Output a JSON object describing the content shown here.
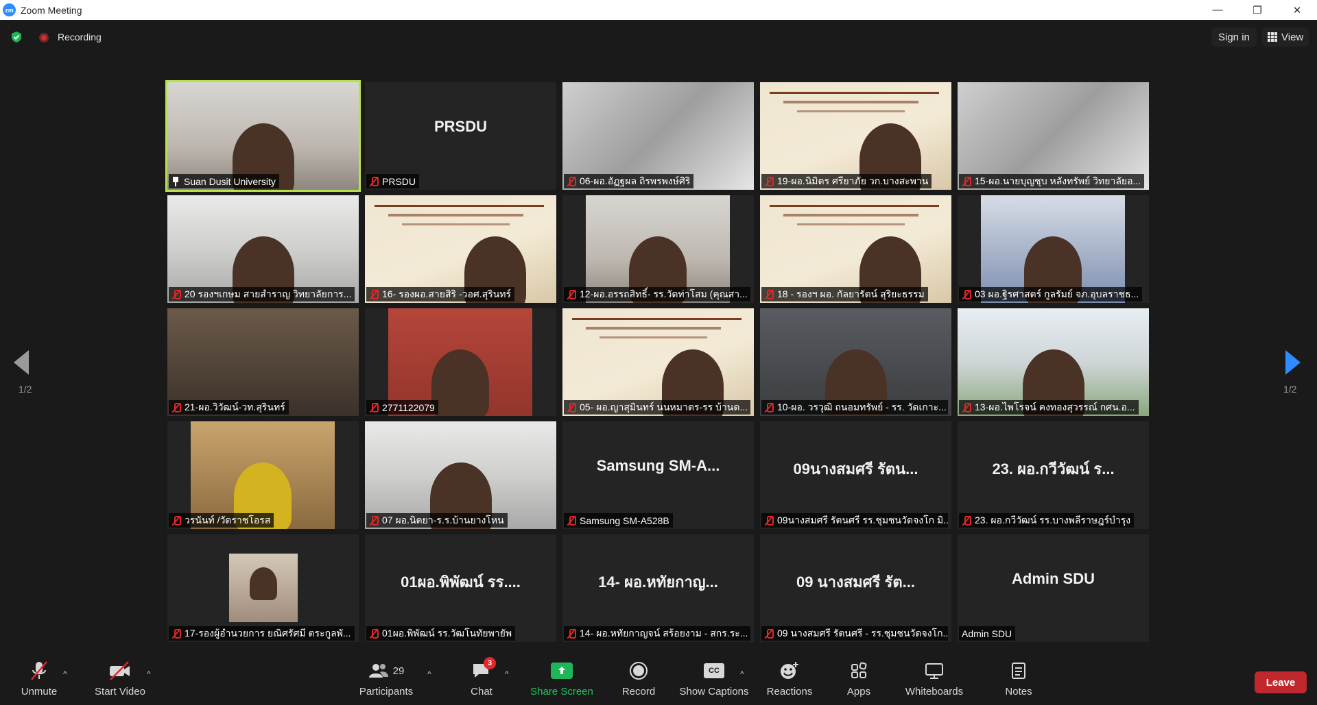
{
  "window": {
    "app_icon_text": "zm",
    "title": "Zoom Meeting",
    "minimize": "—",
    "restore": "❐",
    "close": "✕"
  },
  "topbar": {
    "recording_label": "Recording",
    "sign_in": "Sign in",
    "view": "View"
  },
  "pager": {
    "left": "1/2",
    "right": "1/2"
  },
  "tiles": [
    {
      "label": "Suan Dusit University",
      "name": "",
      "video": "room",
      "active": true,
      "muted": false,
      "pinned": true
    },
    {
      "label": "PRSDU",
      "name": "PRSDU",
      "video": "none",
      "muted": true
    },
    {
      "label": "06-ผอ.อัฏฐผล ถิรพรพงษ์ศิริ",
      "name": "",
      "video": "blur",
      "muted": true
    },
    {
      "label": "19-ผอ.นิมิตร ศรียาภัย  วก.บางสะพาน",
      "name": "",
      "video": "slide",
      "muted": true
    },
    {
      "label": "15-ผอ.นายบุญชุบ หลังทรัพย์ วิทยาลัยอ...",
      "name": "",
      "video": "blur",
      "muted": true
    },
    {
      "label": "20 รองฯเกษม สายสำราญ  วิทยาลัยการ...",
      "name": "",
      "video": "office",
      "muted": true
    },
    {
      "label": "16- รองผอ.สายสิริ -วอศ.สุรินทร์",
      "name": "",
      "video": "slide",
      "muted": true
    },
    {
      "label": "12-ผอ.อรรถสิทธิ์- รร.วัดท่าโสม (คุณสา...",
      "name": "",
      "video": "room",
      "muted": true
    },
    {
      "label": "18 - รองฯ ผอ. กัลยารัตน์  สุริยะธรรม",
      "name": "",
      "video": "slide",
      "muted": true
    },
    {
      "label": "03 ผอ.ฐิรศาสตร์  กูลรัมย์  จภ.อุบลราชธ...",
      "name": "",
      "video": "blue",
      "muted": true
    },
    {
      "label": "21-ผอ.วิวัฒน์-วท.สุรินทร์",
      "name": "",
      "video": "dark",
      "muted": true
    },
    {
      "label": "2771122079",
      "name": "",
      "video": "red",
      "muted": true
    },
    {
      "label": "05- ผอ.ญาสุมินทร์ นนหมาตร-รร บ้านด...",
      "name": "",
      "video": "slide",
      "muted": true
    },
    {
      "label": "10-ผอ. วรวุฒิ ถนอมทรัพย์ - รร. วัดเกาะ...",
      "name": "",
      "video": "grey",
      "muted": true
    },
    {
      "label": "13-ผอ.ไพโรจน์ คงทองสุวรรณ์ กศน.อ...",
      "name": "",
      "video": "out",
      "muted": true
    },
    {
      "label": "วรนันท์ /วัดราชโอรส",
      "name": "",
      "video": "yellow",
      "muted": true
    },
    {
      "label": "07 ผอ.นิตยา-ร.ร.บ้านยางโหน",
      "name": "",
      "video": "office",
      "muted": true
    },
    {
      "label": "Samsung SM-A528B",
      "name": "Samsung  SM-A...",
      "video": "none",
      "muted": true
    },
    {
      "label": "09นางสมศรี รัตนศรี รร.ชุมชนวัดจงโก มิ...",
      "name": "09นางสมศรี  รัตน...",
      "video": "none",
      "muted": true
    },
    {
      "label": "23. ผอ.กวีวัฒน์  รร.บางพลีราษฎร์บำรุง",
      "name": "23. ผอ.กวีวัฒน์  ร...",
      "video": "none",
      "muted": true
    },
    {
      "label": "17-รองผู้อำนวยการ ยณิศรัศมี ตระกูลพั...",
      "name": "",
      "video": "portrait",
      "muted": true
    },
    {
      "label": "01ผอ.พิพัฒน์ รร.วัฒโนทัยพายัพ",
      "name": "01ผอ.พิพัฒน์  รร....",
      "video": "none",
      "muted": true
    },
    {
      "label": "14- ผอ.หทัยกาญจน์ สร้อยงาม - สกร.ระ...",
      "name": "14- ผอ.หทัยกาญ...",
      "video": "none",
      "muted": true
    },
    {
      "label": "09 นางสมศรี รัตนศรี - รร.ชุมชนวัดจงโก...",
      "name": "09  นางสมศรี  รัต...",
      "video": "none",
      "muted": true
    },
    {
      "label": "Admin SDU",
      "name": "Admin SDU",
      "video": "none",
      "muted": false
    }
  ],
  "toolbar": {
    "unmute": "Unmute",
    "start_video": "Start Video",
    "participants": "Participants",
    "participants_count": "29",
    "chat": "Chat",
    "chat_badge": "3",
    "share_screen": "Share Screen",
    "record": "Record",
    "captions": "Show Captions",
    "cc": "CC",
    "reactions": "Reactions",
    "apps": "Apps",
    "whiteboards": "Whiteboards",
    "notes": "Notes",
    "leave": "Leave"
  },
  "colors": {
    "accent": "#2d8cff",
    "active_speaker": "#b7e24a",
    "share_green": "#1fb65a",
    "leave_red": "#c0282d",
    "muted_red": "#e02828"
  }
}
